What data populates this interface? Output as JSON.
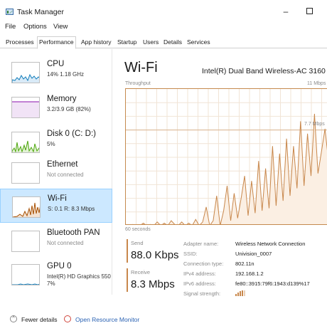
{
  "window": {
    "title": "Task Manager",
    "min_glyph": "–"
  },
  "menu": [
    "File",
    "Options",
    "View"
  ],
  "tabs": [
    "Processes",
    "Performance",
    "App history",
    "Startup",
    "Users",
    "Details",
    "Services"
  ],
  "active_tab": "Performance",
  "sidebar": [
    {
      "name": "CPU",
      "sub": "14% 1.18 GHz",
      "muted": false,
      "color": "#117dbb"
    },
    {
      "name": "Memory",
      "sub": "3.2/3.9 GB (82%)",
      "muted": false,
      "color": "#8b12ae"
    },
    {
      "name": "Disk 0 (C: D:)",
      "sub": "5%",
      "muted": false,
      "color": "#4da60c"
    },
    {
      "name": "Ethernet",
      "sub": "Not connected",
      "muted": true,
      "color": "#a74f01"
    },
    {
      "name": "Wi-Fi",
      "sub": "S: 0.1 R: 8.3 Mbps",
      "muted": false,
      "color": "#a74f01"
    },
    {
      "name": "Bluetooth PAN",
      "sub": "Not connected",
      "muted": true,
      "color": "#a74f01"
    },
    {
      "name": "GPU 0",
      "sub": "Intel(R) HD Graphics 550",
      "sub2": "7%",
      "muted": false,
      "color": "#117dbb"
    }
  ],
  "selected_item": "Wi-Fi",
  "main": {
    "title": "Wi-Fi",
    "adapter": "Intel(R) Dual Band Wireless-AC 3160",
    "graph_label": "Throughput",
    "max_label": "11 Mbps",
    "mid_label": "7.7 Mbps",
    "time_label": "60 seconds",
    "accent": "#c8874b"
  },
  "stats": {
    "send_label": "Send",
    "send_value": "88.0 Kbps",
    "receive_label": "Receive",
    "receive_value": "8.3 Mbps"
  },
  "properties": [
    {
      "name": "Adapter name:",
      "value": "Wireless Network Connection"
    },
    {
      "name": "SSID:",
      "value": "Univision_0007"
    },
    {
      "name": "Connection type:",
      "value": "802.11n"
    },
    {
      "name": "IPv4 address:",
      "value": "192.168.1.2"
    },
    {
      "name": "IPv6 address:",
      "value": "fe80::3915:79f6:1943:d139%17"
    },
    {
      "name": "Signal strength:",
      "value": "",
      "icon": "signal-strength-icon"
    }
  ],
  "footer": {
    "fewer_details": "Fewer details",
    "open_resource_monitor": "Open Resource Monitor"
  }
}
